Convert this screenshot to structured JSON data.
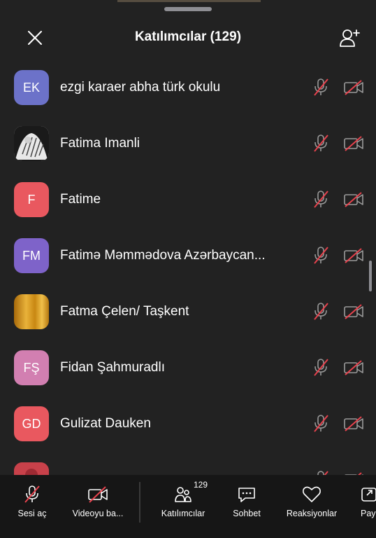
{
  "header": {
    "title": "Katılımcılar (129)"
  },
  "participants": [
    {
      "initials": "EK",
      "name": "ezgi karaer abha türk okulu",
      "avatar_color": "#6C72C9",
      "avatar_type": "initials"
    },
    {
      "initials": "",
      "name": "Fatima Imanli",
      "avatar_color": "#dcdcdc",
      "avatar_type": "photo"
    },
    {
      "initials": "F",
      "name": "Fatime",
      "avatar_color": "#E9585F",
      "avatar_type": "initials"
    },
    {
      "initials": "FM",
      "name": "Fatimə Məmmədova Azərbaycan...",
      "avatar_color": "#7E63C9",
      "avatar_type": "initials"
    },
    {
      "initials": "",
      "name": "Fatma Çelen/ Taşkent",
      "avatar_color": "#D69A1C",
      "avatar_type": "gold"
    },
    {
      "initials": "FŞ",
      "name": "Fidan Şahmuradlı",
      "avatar_color": "#D27FB1",
      "avatar_type": "initials"
    },
    {
      "initials": "GD",
      "name": "Gulizat Dauken",
      "avatar_color": "#E9585F",
      "avatar_type": "initials"
    },
    {
      "initials": "",
      "name": "",
      "avatar_color": "#C8414A",
      "avatar_type": "partial"
    }
  ],
  "bottom_bar": {
    "mic_label": "Sesi aç",
    "video_label": "Videoyu ba...",
    "participants_label": "Katılımcılar",
    "participants_count": "129",
    "chat_label": "Sohbet",
    "reactions_label": "Reaksiyonlar",
    "share_label": "Pay"
  },
  "colors": {
    "background": "#222222",
    "bottom_bar": "#161616",
    "muted_red": "#E8424D"
  }
}
